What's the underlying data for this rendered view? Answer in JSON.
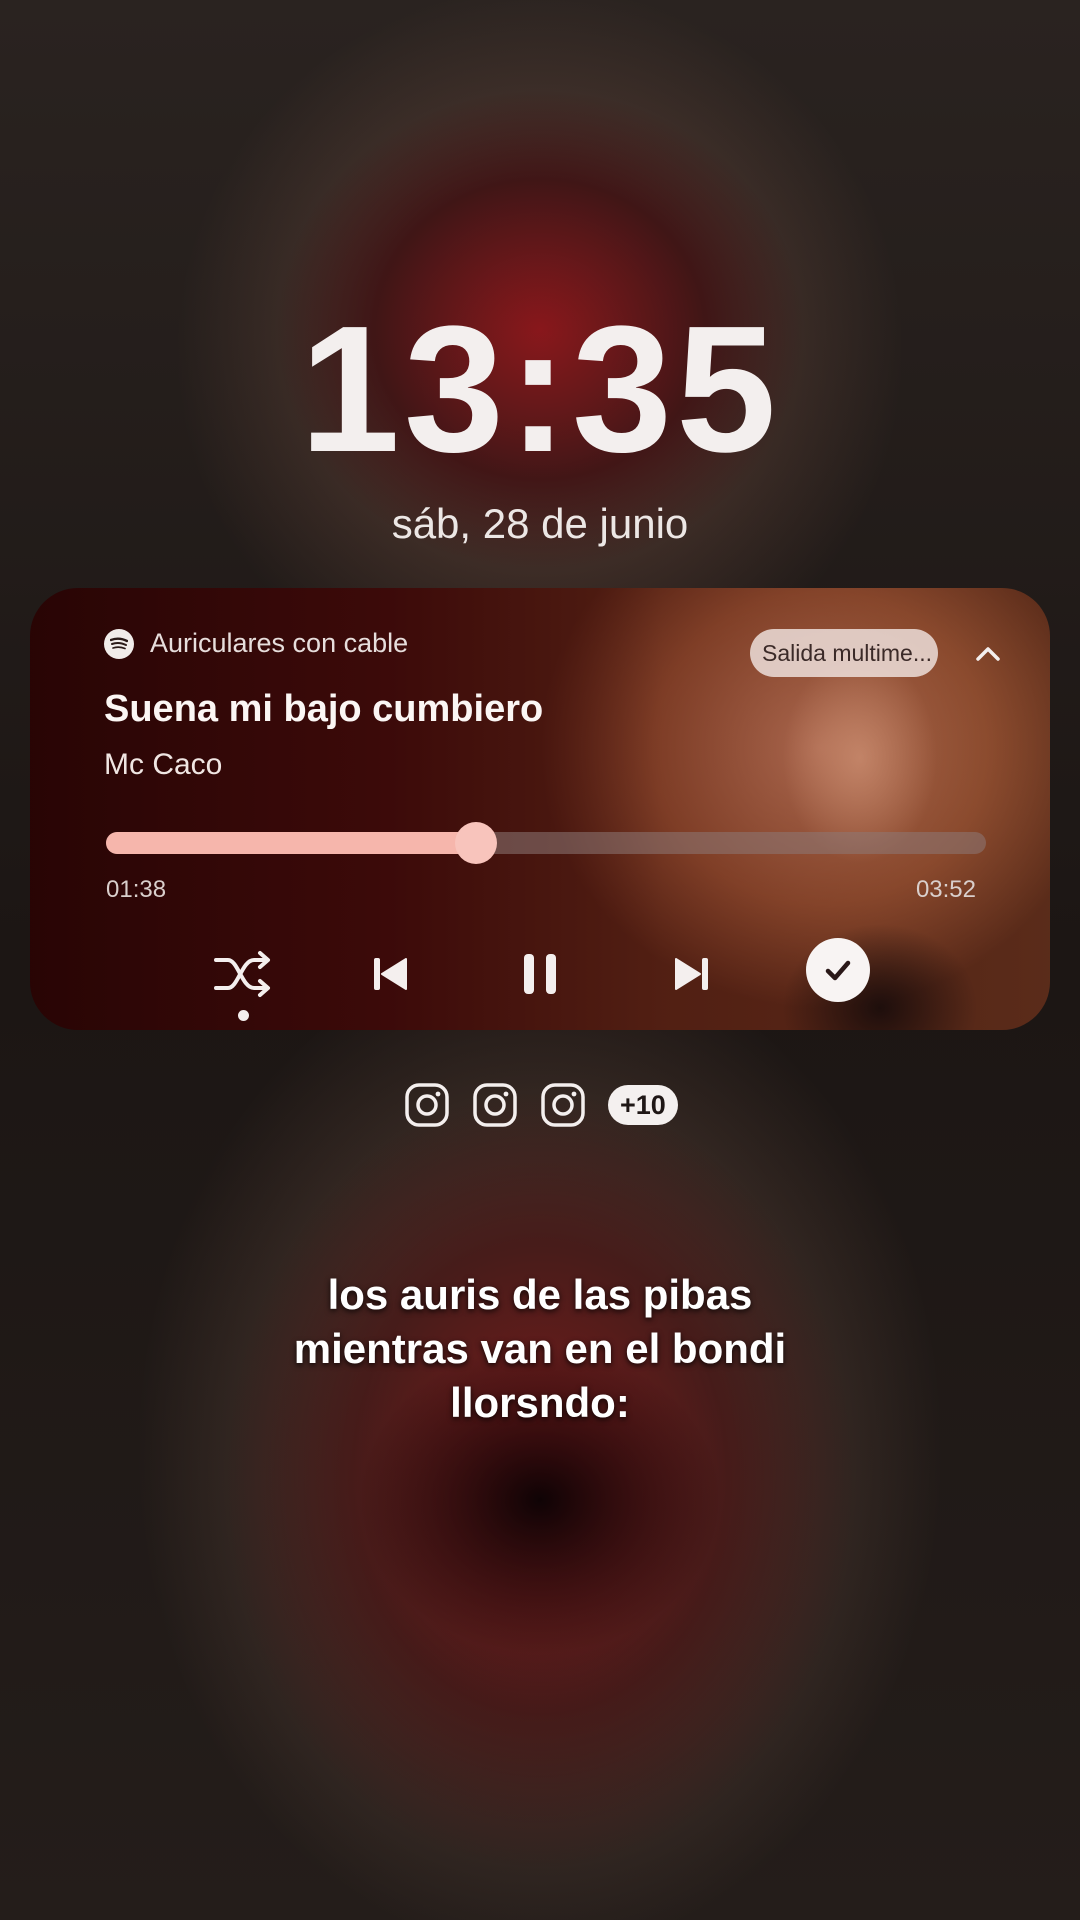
{
  "lockscreen": {
    "time": "13:35",
    "date": "sáb, 28 de junio"
  },
  "media_player": {
    "source_app_icon": "spotify-icon",
    "source_label": "Auriculares con cable",
    "output_chip_label": "Salida multime...",
    "song_title": "Suena mi bajo cumbiero",
    "artist": "Mc Caco",
    "elapsed": "01:38",
    "duration": "03:52",
    "progress": 0.42,
    "accent_color": "#f6b6ac",
    "controls": [
      "shuffle-icon",
      "previous-icon",
      "pause-icon",
      "next-icon",
      "check-icon"
    ]
  },
  "notifications": {
    "icons": [
      "instagram-icon",
      "instagram-icon",
      "instagram-icon"
    ],
    "more_count": "+10"
  },
  "caption": {
    "line1": "los auris de las pibas",
    "line2": "mientras van en el bondi",
    "line3": "llorsndo:"
  }
}
